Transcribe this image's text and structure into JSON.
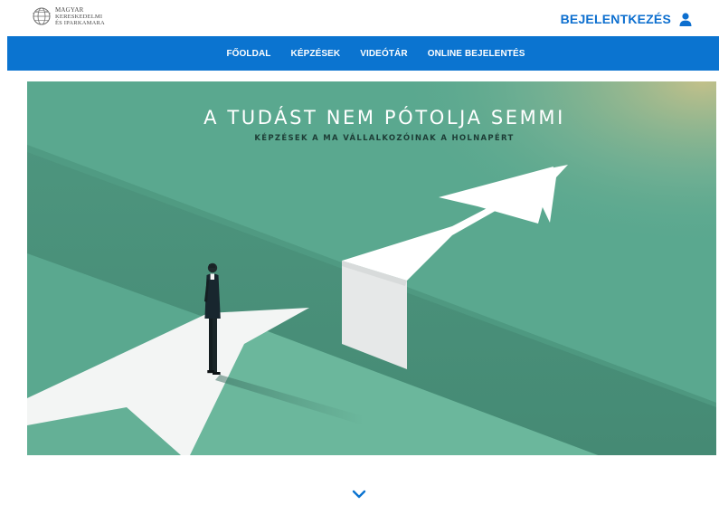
{
  "brand": {
    "logo_lines": [
      "MAGYAR",
      "KERESKEDELMI",
      "ÉS IPARKAMARA"
    ],
    "logo_icon": "globe-icon"
  },
  "header": {
    "login_label": "BEJELENTKEZÉS",
    "login_icon": "user-icon"
  },
  "nav": {
    "items": [
      {
        "label": "FŐOLDAL"
      },
      {
        "label": "KÉPZÉSEK"
      },
      {
        "label": "VIDEÓTÁR"
      },
      {
        "label": "ONLINE BEJELENTÉS"
      }
    ]
  },
  "hero": {
    "title": "A TUDÁST NEM PÓTOLJA SEMMI",
    "subtitle": "KÉPZÉSEK A MA VÁLLALKOZÓINAK A HOLNAPÉRT"
  },
  "scroll": {
    "icon": "chevron-down-icon"
  },
  "colors": {
    "brand_blue": "#0b74d0",
    "hero_green": "#5aa88f",
    "hero_dark": "#4a8f79",
    "hero_light": "#6bb79c"
  }
}
